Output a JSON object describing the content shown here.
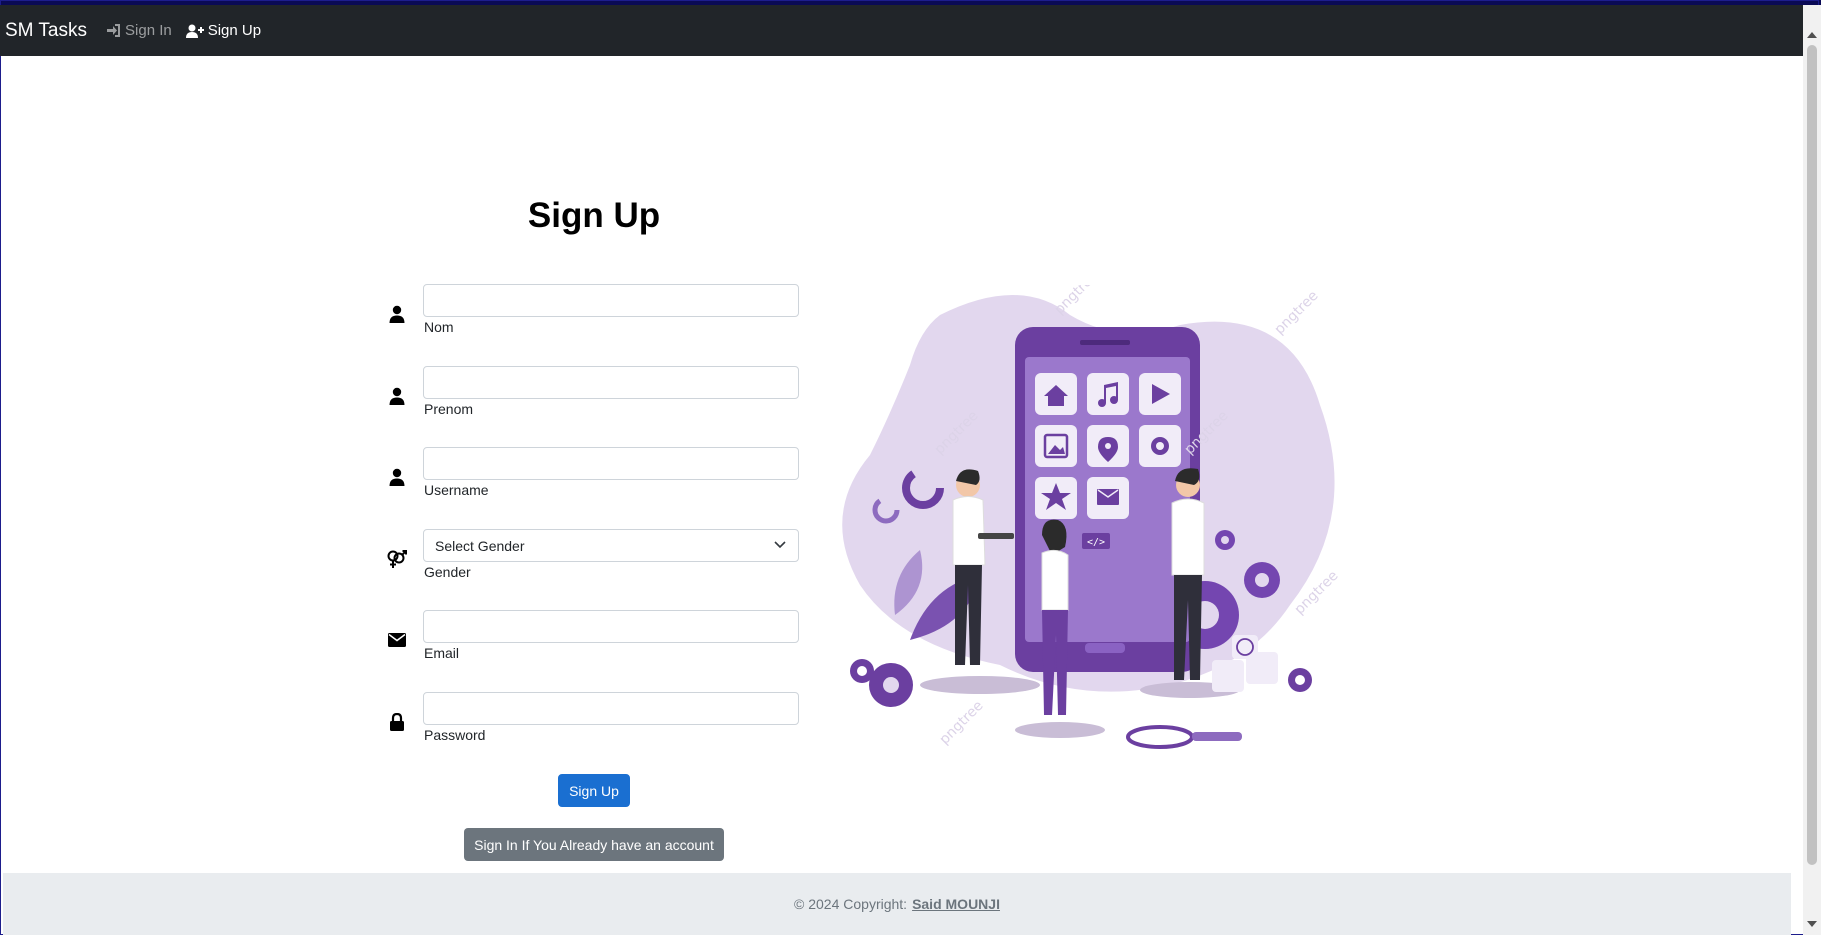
{
  "navbar": {
    "brand": "SM Tasks",
    "links": [
      {
        "label": "Sign In",
        "icon": "sign-in-icon"
      },
      {
        "label": "Sign Up",
        "icon": "user-plus-icon"
      }
    ]
  },
  "form": {
    "title": "Sign Up",
    "fields": [
      {
        "label": "Nom",
        "icon": "user-icon",
        "value": ""
      },
      {
        "label": "Prenom",
        "icon": "user-icon",
        "value": ""
      },
      {
        "label": "Username",
        "icon": "user-icon",
        "value": ""
      },
      {
        "label": "Gender",
        "icon": "gender-icon",
        "selected": "Select Gender"
      },
      {
        "label": "Email",
        "icon": "envelope-icon",
        "value": ""
      },
      {
        "label": "Password",
        "icon": "lock-icon",
        "value": ""
      }
    ],
    "submit_label": "Sign Up",
    "signin_label": "Sign In If You Already have an account"
  },
  "footer": {
    "copyright": "© 2024 Copyright:",
    "author": "Said MOUNJI"
  },
  "illustration": {
    "icon": "team-building-app-illustration",
    "code_tag": "</>",
    "watermark": "pngtree"
  },
  "colors": {
    "navbar_bg": "#212529",
    "primary": "#1a6fd1",
    "secondary": "#6c757d",
    "illustration_purple": "#6b3fa0"
  }
}
